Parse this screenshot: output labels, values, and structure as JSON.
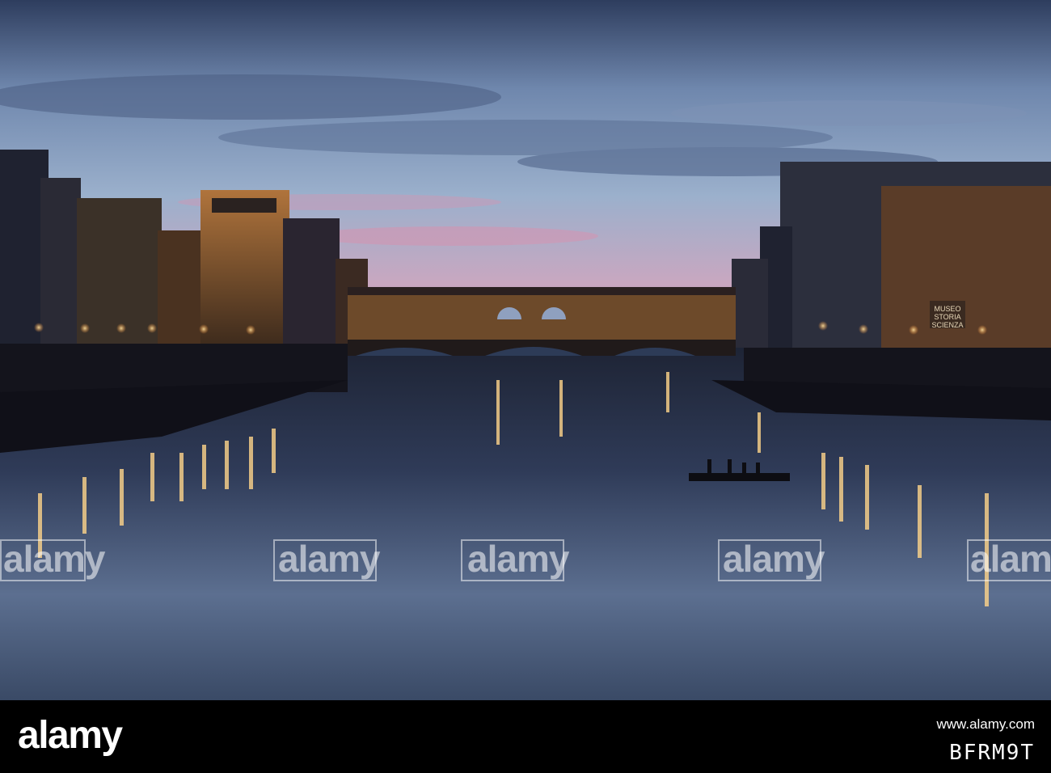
{
  "photo": {
    "alt": "",
    "colors": {
      "sky_top": "#2c3a58",
      "sky_mid": "#8fa7c7",
      "sky_pink": "#d89bb0",
      "water": "#2d3b57",
      "lamp": "#ffd27a",
      "building_dark": "#171820",
      "building_lit": "#6b4a2a"
    },
    "sign_lines": [
      "MUSEO",
      "STORIA",
      "SCIENZA"
    ]
  },
  "watermarks": [
    {
      "text": "alamy"
    },
    {
      "text": "alamy"
    },
    {
      "text": "alamy"
    },
    {
      "text": "alamy"
    },
    {
      "text": "alamy"
    }
  ],
  "footer": {
    "logo": "alamy",
    "url": "www.alamy.com",
    "image_id": "BFRM9T"
  }
}
